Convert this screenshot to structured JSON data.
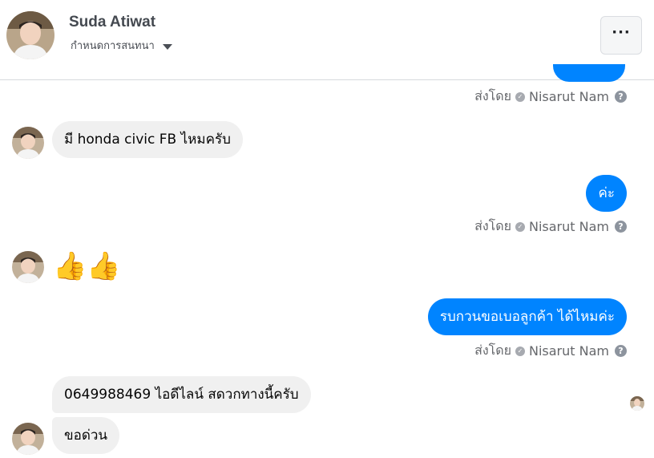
{
  "header": {
    "name": "Suda Atiwat",
    "subtitle": "กำหนดการสนทนา",
    "more_label": "···"
  },
  "sent_by": {
    "prefix": "ส่งโดย",
    "author": "Nisarut Nam",
    "help": "?"
  },
  "messages": [
    {
      "direction": "in",
      "text": "มี honda civic FB ไหมครับ"
    },
    {
      "direction": "out",
      "text": "ค่ะ"
    },
    {
      "direction": "in",
      "text": "👍👍"
    },
    {
      "direction": "out",
      "text": "รบกวนขอเบอลูกค้า ได้ไหมค่ะ"
    },
    {
      "direction": "in",
      "text": "0649988469  ไอดีไลน์  สดวกทางนี้ครับ"
    },
    {
      "direction": "in",
      "text": "ขอด่วน"
    }
  ],
  "colors": {
    "outgoing_bubble": "#0084ff",
    "incoming_bubble": "#f0f0f0",
    "meta_text": "#65676b"
  },
  "icons": {
    "avatar": "profile-photo",
    "more": "ellipsis-icon",
    "dropdown": "caret-down-icon",
    "check": "sent-check-icon",
    "help": "question-circle-icon"
  }
}
